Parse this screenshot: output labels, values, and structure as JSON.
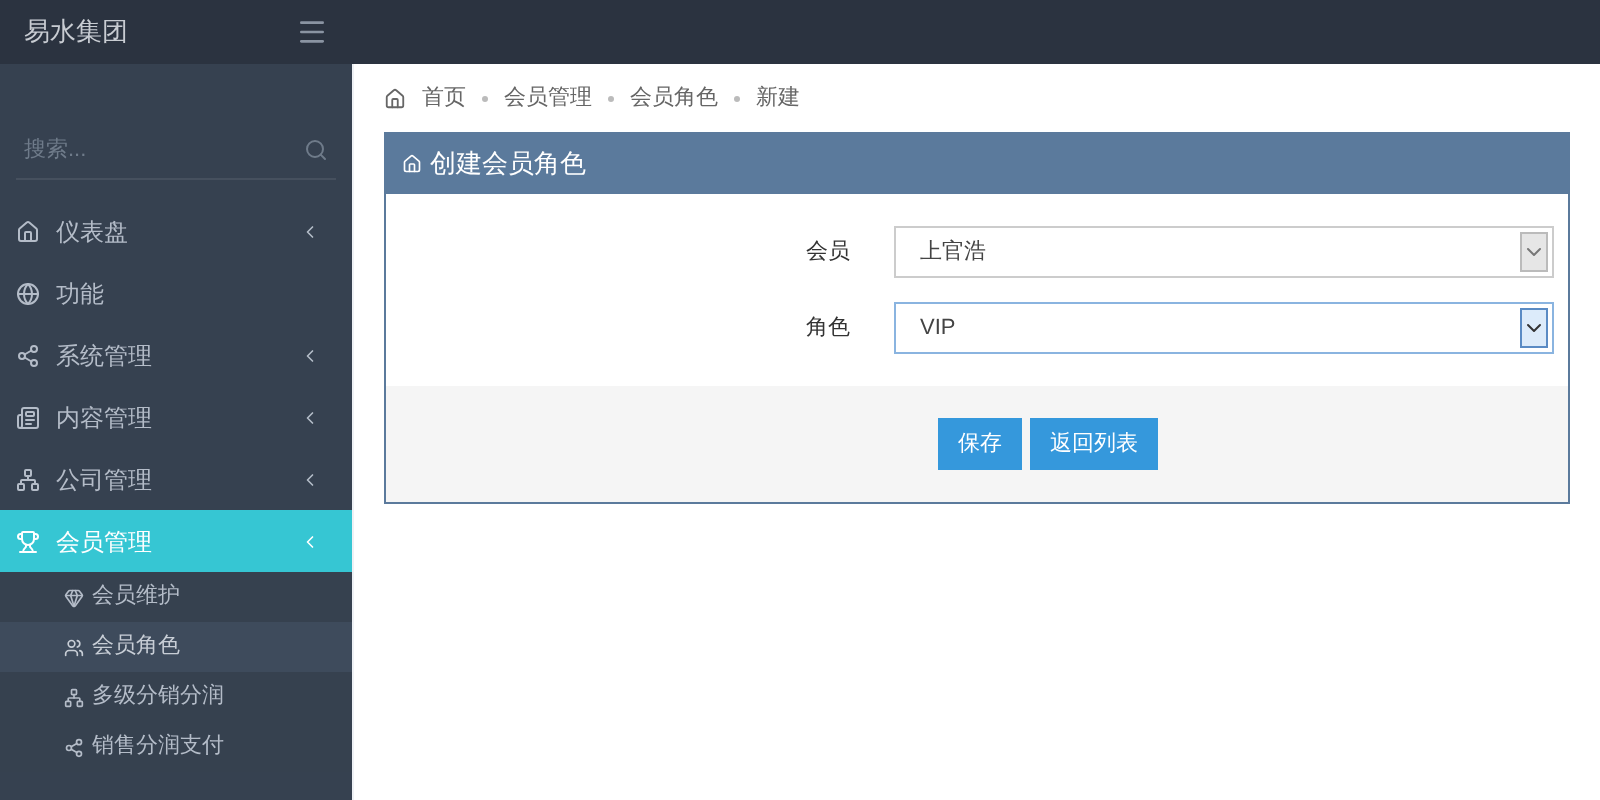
{
  "app": {
    "title": "易水集团"
  },
  "sidebar": {
    "search": {
      "placeholder": "搜索..."
    },
    "items": [
      {
        "label": "仪表盘",
        "expandable": true,
        "selected": false
      },
      {
        "label": "功能",
        "expandable": false,
        "selected": false
      },
      {
        "label": "系统管理",
        "expandable": true,
        "selected": false
      },
      {
        "label": "内容管理",
        "expandable": true,
        "selected": false
      },
      {
        "label": "公司管理",
        "expandable": true,
        "selected": false
      },
      {
        "label": "会员管理",
        "expandable": true,
        "selected": true,
        "children": [
          {
            "label": "会员维护",
            "selected": false
          },
          {
            "label": "会员角色",
            "selected": true
          },
          {
            "label": "多级分销分润",
            "selected": false
          },
          {
            "label": "销售分润支付",
            "selected": false
          }
        ]
      }
    ]
  },
  "breadcrumb": [
    "首页",
    "会员管理",
    "会员角色",
    "新建"
  ],
  "panel": {
    "title": "创建会员角色",
    "fields": [
      {
        "label": "会员",
        "value": "上官浩",
        "focused": false
      },
      {
        "label": "角色",
        "value": "VIP",
        "focused": true
      }
    ],
    "buttons": [
      {
        "label": "保存"
      },
      {
        "label": "返回列表"
      }
    ]
  }
}
